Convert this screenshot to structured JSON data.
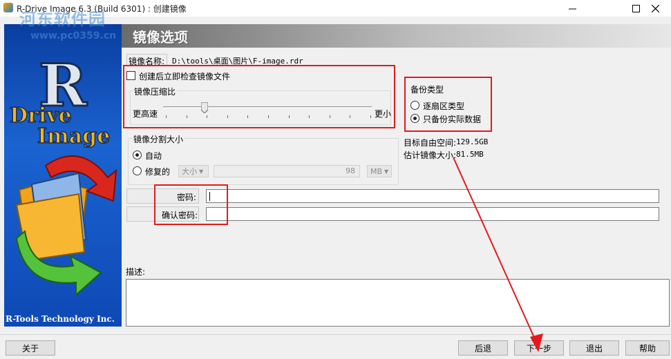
{
  "window": {
    "title": "R-Drive Image 6.3 (Build 6301) : 创建镜像",
    "minimize_icon": "minimize-icon",
    "maximize_icon": "maximize-icon",
    "close_icon": "close-icon"
  },
  "watermark": {
    "text": "河东软件园",
    "url": "www.pc0359.cn"
  },
  "banner": {
    "logo_letter": "R",
    "logo_line1": "Drive",
    "logo_line2": "Image",
    "footer": "R-Tools Technology Inc."
  },
  "header": {
    "title": "镜像选项"
  },
  "image_name": {
    "label": "镜像名称:",
    "value": "D:\\tools\\桌面\\图片\\F-image.rdr"
  },
  "verify": {
    "label": "创建后立即检查镜像文件",
    "checked": false
  },
  "compression": {
    "group_label": "镜像压缩比",
    "left_label": "更高速",
    "right_label": "更小",
    "level": 0.2
  },
  "backup_type": {
    "group_label": "备份类型",
    "options": [
      {
        "label": "逐扇区类型",
        "selected": false
      },
      {
        "label": "只备份实际数据",
        "selected": true
      }
    ]
  },
  "space": {
    "free_label": "目标自由空间:",
    "free_value": "129.5GB",
    "est_label": "估计镜像大小:",
    "est_value": "81.5MB"
  },
  "split": {
    "group_label": "镜像分割大小",
    "auto_label": "自动",
    "fixed_label": "修复的",
    "size_combo": "大小",
    "size_value": "98",
    "unit_combo": "MB"
  },
  "password": {
    "label": "密码:",
    "confirm_label": "确认密码:"
  },
  "description": {
    "label": "描述:"
  },
  "buttons": {
    "about": "关于",
    "back": "后退",
    "next": "下一步",
    "exit": "退出",
    "help": "帮助"
  },
  "colors": {
    "annotation_red": "#e5191b",
    "banner_blue": "#1b63d0"
  }
}
